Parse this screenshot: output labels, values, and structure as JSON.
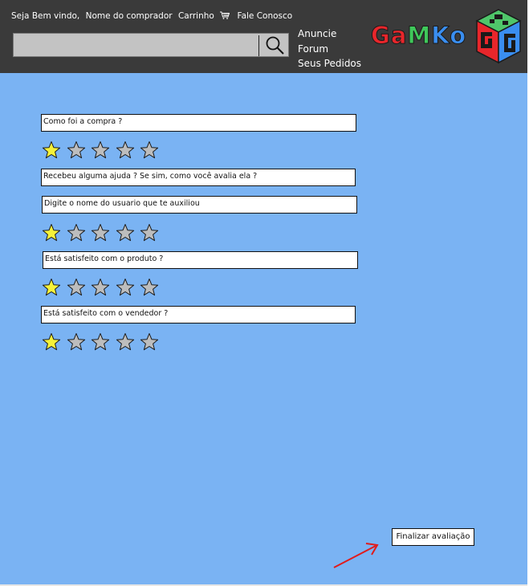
{
  "header": {
    "welcome": "Seja Bem vindo,",
    "buyer": "Nome do comprador",
    "cart": "Carrinho",
    "contact": "Fale Conosco",
    "search_placeholder": "",
    "nav": [
      "Anuncie",
      "Forum",
      "Seus Pedidos"
    ],
    "brand": {
      "g": "G",
      "a": "a",
      "m": "M",
      "k": "K",
      "o": "o"
    }
  },
  "questions": [
    {
      "text": "Como foi a compra ?",
      "rating": 1
    },
    {
      "text": "Recebeu alguma ajuda ? Se sim,  como você avalia ela ?"
    },
    {
      "text": "Digite o nome do usuario que te auxiliou",
      "rating": 1
    },
    {
      "text": "Está satisfeito com o produto ?",
      "rating": 1
    },
    {
      "text": "Está satisfeito com o vendedor ?",
      "rating": 1
    }
  ],
  "rating_max": 5,
  "finish_label": "Finalizar avaliação",
  "colors": {
    "header_bg": "#3a3a3a",
    "content_bg": "#7ab3f3",
    "star_filled": "#f5f23a",
    "star_empty": "#bdbdbd",
    "arrow": "#e11b1b"
  }
}
